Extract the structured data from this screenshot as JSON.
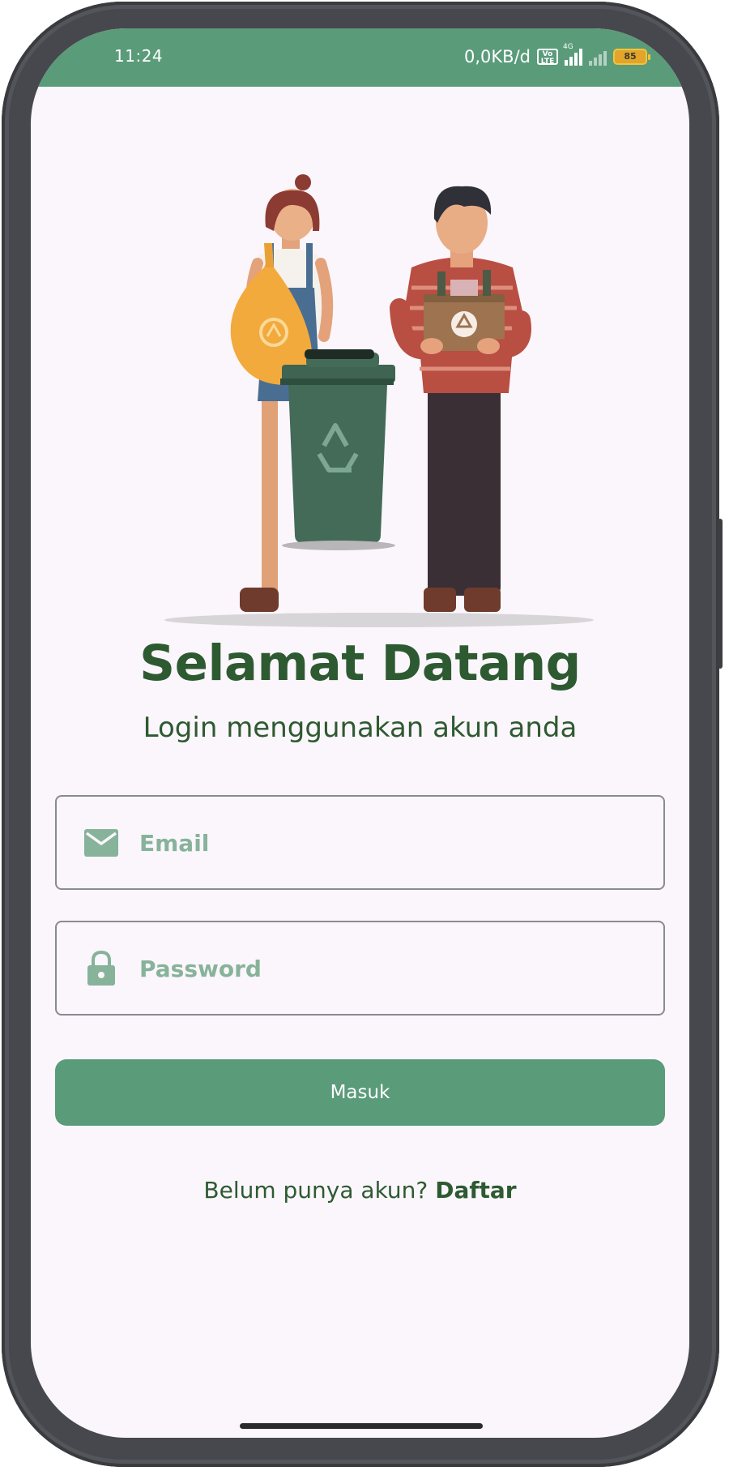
{
  "status_bar": {
    "time": "11:24",
    "network_speed": "0,0KB/d",
    "volte": "Vo LTE",
    "network_type": "4G",
    "battery": "85"
  },
  "login": {
    "title": "Selamat Datang",
    "subtitle": "Login menggunakan akun anda",
    "email_placeholder": "Email",
    "password_placeholder": "Password",
    "submit_label": "Masuk",
    "register_prompt": "Belum punya akun?",
    "register_link": "Daftar"
  },
  "colors": {
    "accent": "#5a9b7a",
    "title": "#2e5a32",
    "placeholder": "#86b39a",
    "background": "#fbf6fb",
    "frame": "#47484d"
  },
  "icons": [
    "mail-icon",
    "lock-icon",
    "recycle-icon"
  ]
}
